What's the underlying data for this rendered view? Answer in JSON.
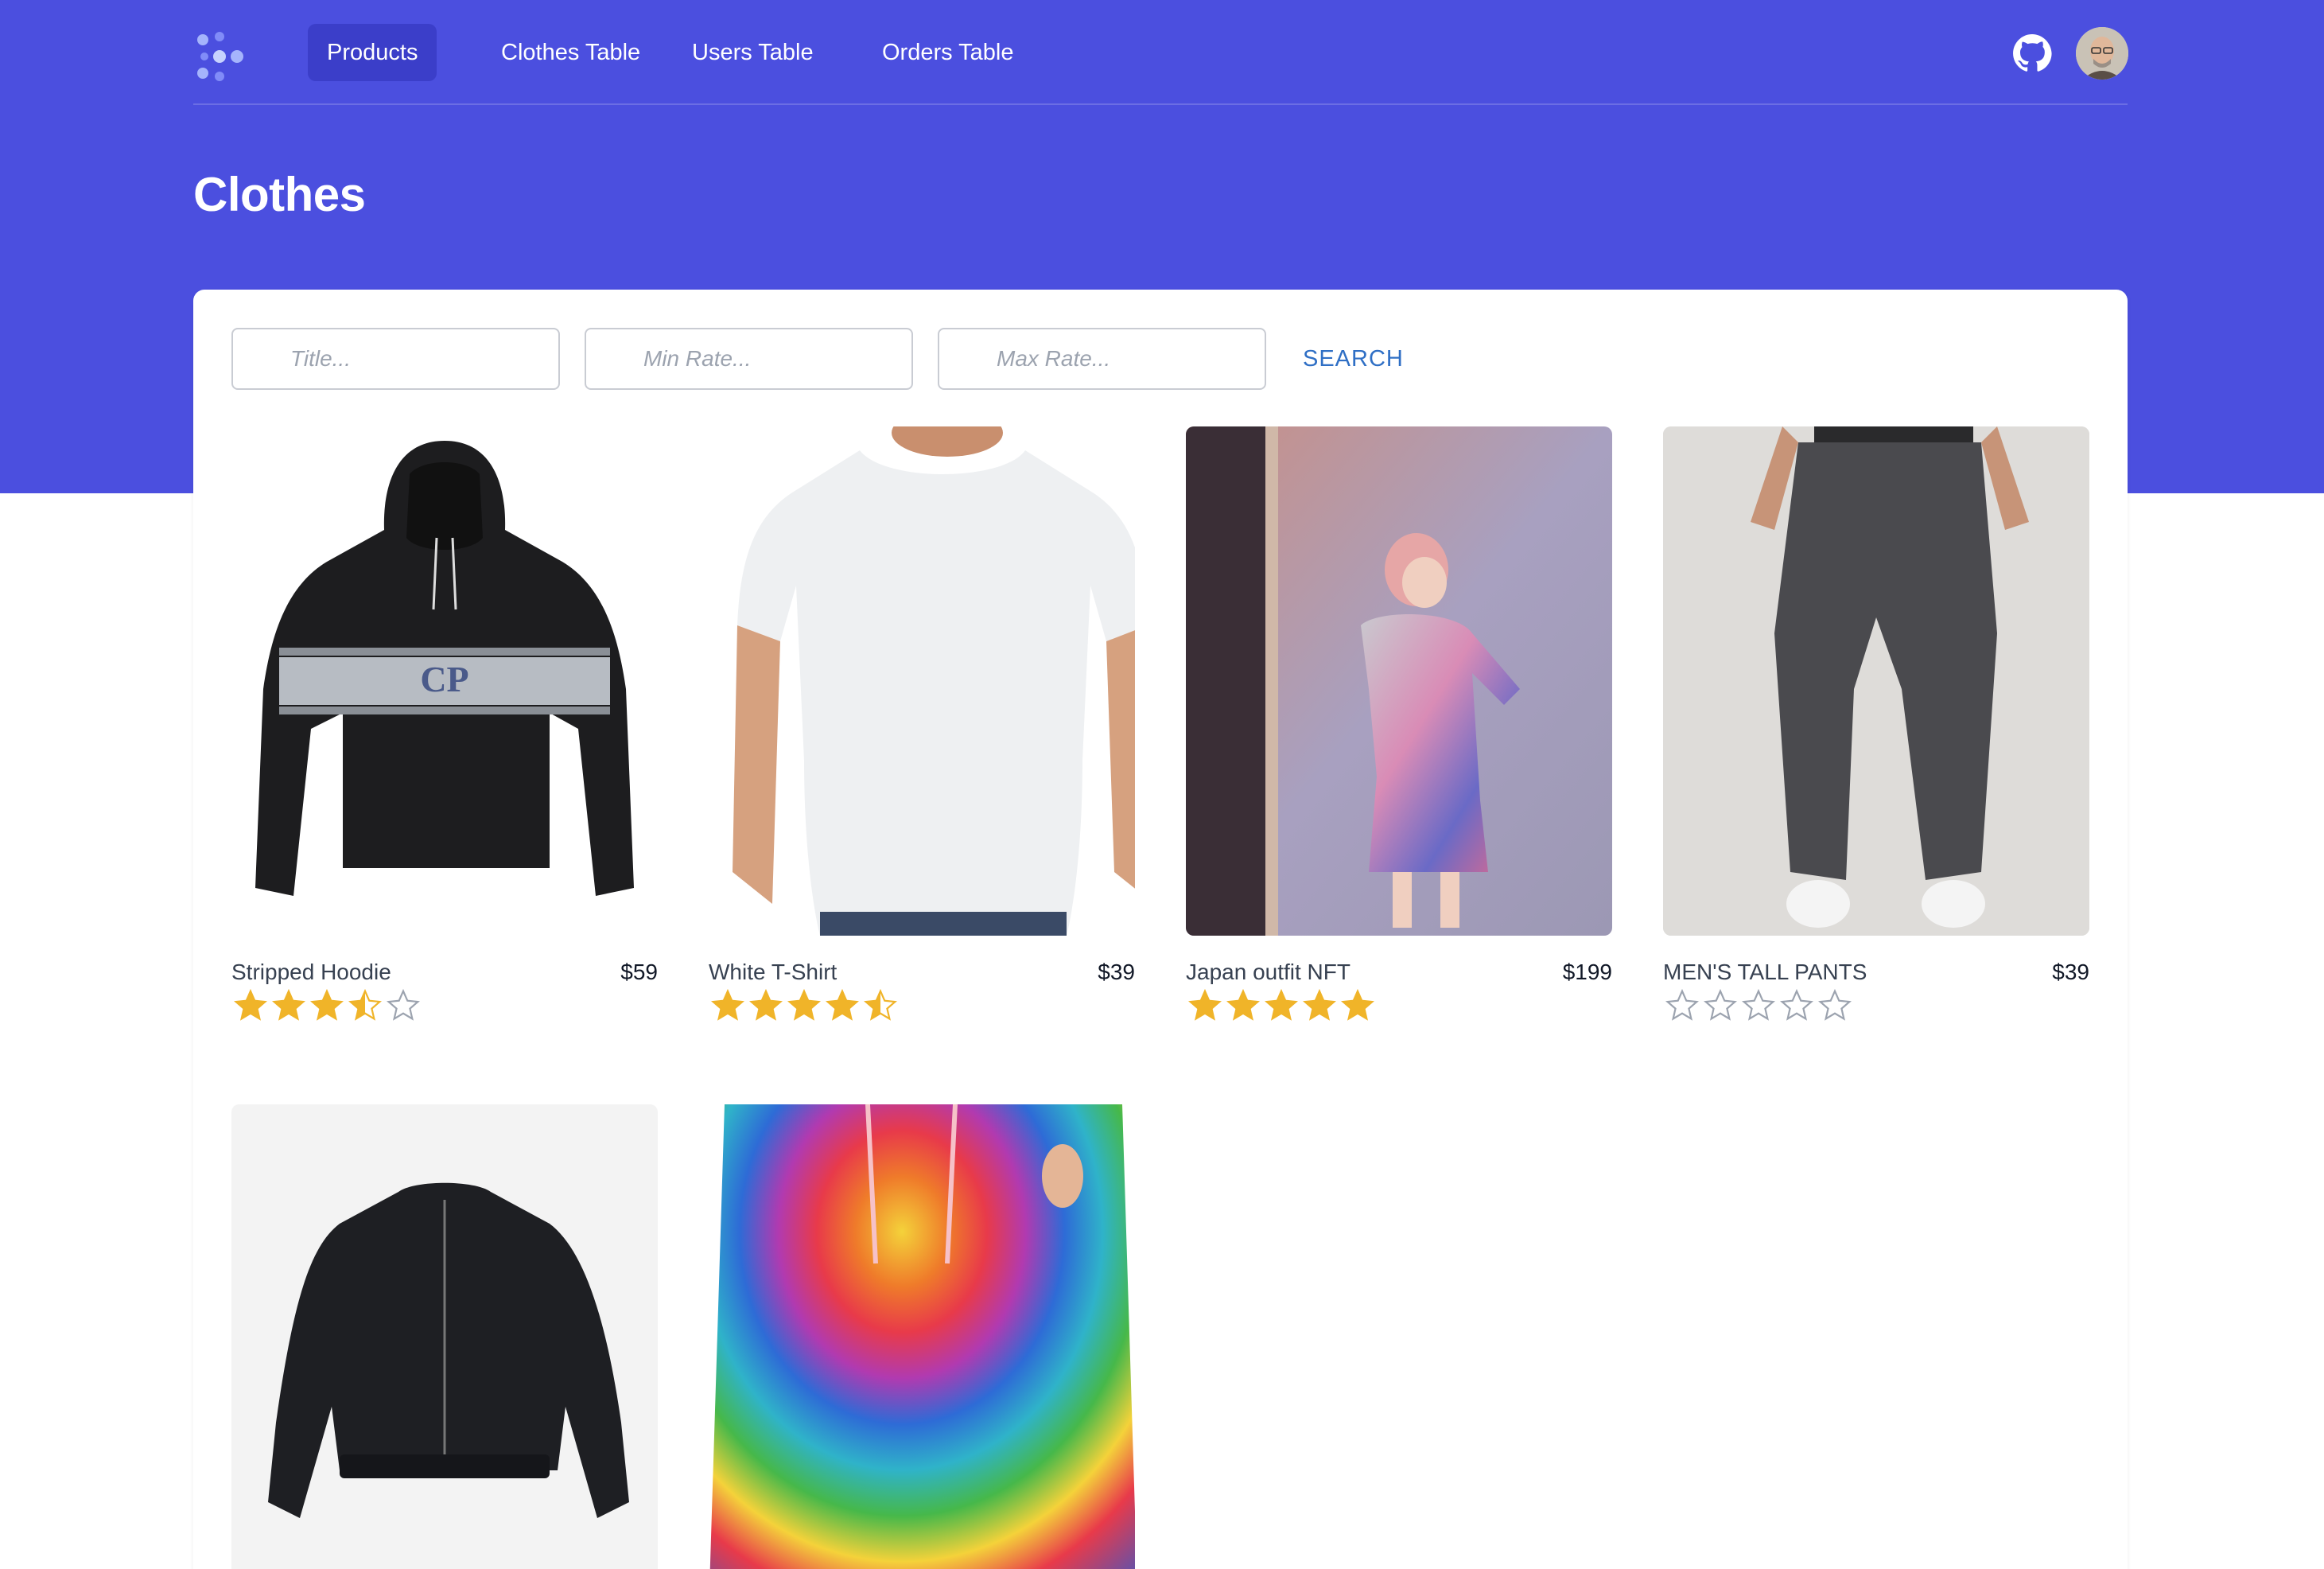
{
  "nav": {
    "links": [
      {
        "label": "Products",
        "active": true
      },
      {
        "label": "Clothes Table",
        "active": false
      },
      {
        "label": "Users Table",
        "active": false
      },
      {
        "label": "Orders Table",
        "active": false
      }
    ],
    "icons": [
      "logo-icon",
      "github-icon",
      "user-avatar"
    ]
  },
  "page": {
    "title": "Clothes"
  },
  "filters": {
    "title_placeholder": "Title...",
    "min_rate_placeholder": "Min Rate...",
    "max_rate_placeholder": "Max Rate...",
    "search_label": "SEARCH"
  },
  "products": [
    {
      "name": "Stripped Hoodie",
      "price": "$59",
      "rating": 3.5
    },
    {
      "name": "White T-Shirt",
      "price": "$39",
      "rating": 4.5
    },
    {
      "name": "Japan outfit NFT",
      "price": "$199",
      "rating": 5
    },
    {
      "name": "MEN'S TALL PANTS",
      "price": "$39",
      "rating": 0
    },
    {
      "name": "",
      "price": "",
      "rating": null
    },
    {
      "name": "",
      "price": "",
      "rating": null
    }
  ],
  "colors": {
    "brand": "#4b4fdf",
    "nav_active": "#3b3ec9",
    "star": "#f0b429",
    "link": "#2f6fc5"
  }
}
